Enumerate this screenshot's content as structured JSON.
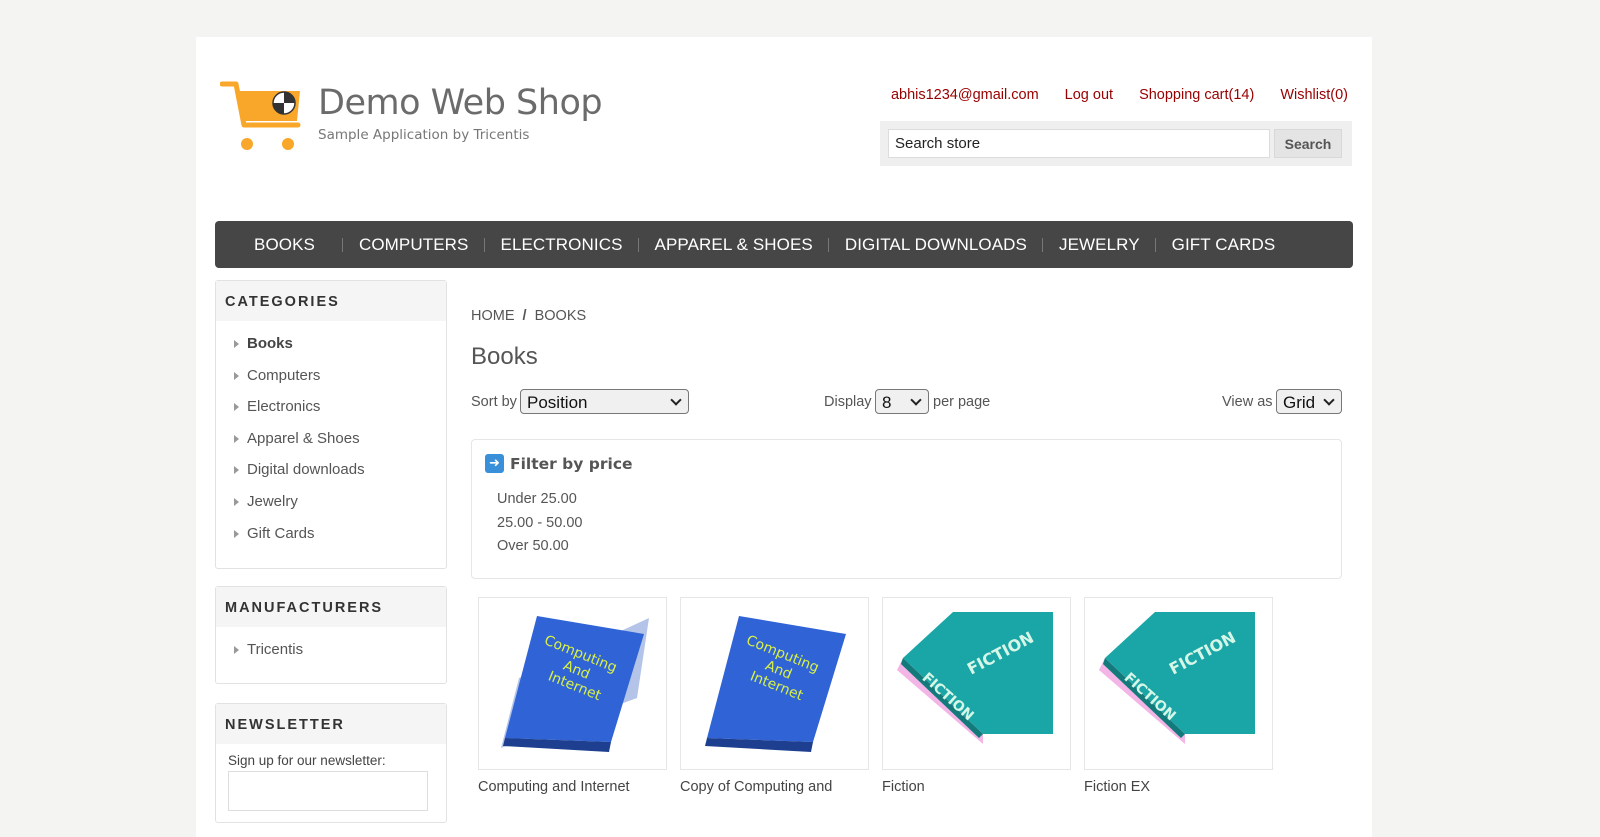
{
  "brand": {
    "title": "Demo Web Shop",
    "subtitle": "Sample Application by Tricentis",
    "accent": "#f9a72b"
  },
  "header": {
    "account": "abhis1234@gmail.com",
    "logout": "Log out",
    "cart": "Shopping cart(14)",
    "wishlist": "Wishlist(0)",
    "link_color": "#990000"
  },
  "search": {
    "value": "Search store",
    "button": "Search"
  },
  "menu": [
    "BOOKS",
    "COMPUTERS",
    "ELECTRONICS",
    "APPAREL & SHOES",
    "DIGITAL DOWNLOADS",
    "JEWELRY",
    "GIFT CARDS"
  ],
  "sidebar": {
    "categories_title": "CATEGORIES",
    "categories": [
      "Books",
      "Computers",
      "Electronics",
      "Apparel & Shoes",
      "Digital downloads",
      "Jewelry",
      "Gift Cards"
    ],
    "manufacturers_title": "MANUFACTURERS",
    "manufacturers": [
      "Tricentis"
    ],
    "newsletter_title": "NEWSLETTER",
    "newsletter_label": "Sign up for our newsletter:"
  },
  "breadcrumb": {
    "home": "HOME",
    "sep": "/",
    "current": "BOOKS"
  },
  "page_title": "Books",
  "sorting": {
    "sort_label": "Sort by",
    "sort_value": "Position",
    "display_label": "Display",
    "display_value": "8",
    "per_page": "per page",
    "view_label": "View as",
    "view_value": "Grid"
  },
  "filter": {
    "title": "Filter by price",
    "options": [
      "Under 25.00",
      "25.00 - 50.00",
      "Over 50.00"
    ]
  },
  "products": [
    {
      "name": "Computing and Internet",
      "cover_text": "Computing And Internet",
      "cover_color": "#2f63d6"
    },
    {
      "name": "Copy of Computing and",
      "cover_text": "Computing And Internet",
      "cover_color": "#2f63d6"
    },
    {
      "name": "Fiction",
      "cover_text": "FICTION",
      "cover_color": "#1aa6a6"
    },
    {
      "name": "Fiction EX",
      "cover_text": "FICTION",
      "cover_color": "#1aa6a6"
    }
  ]
}
